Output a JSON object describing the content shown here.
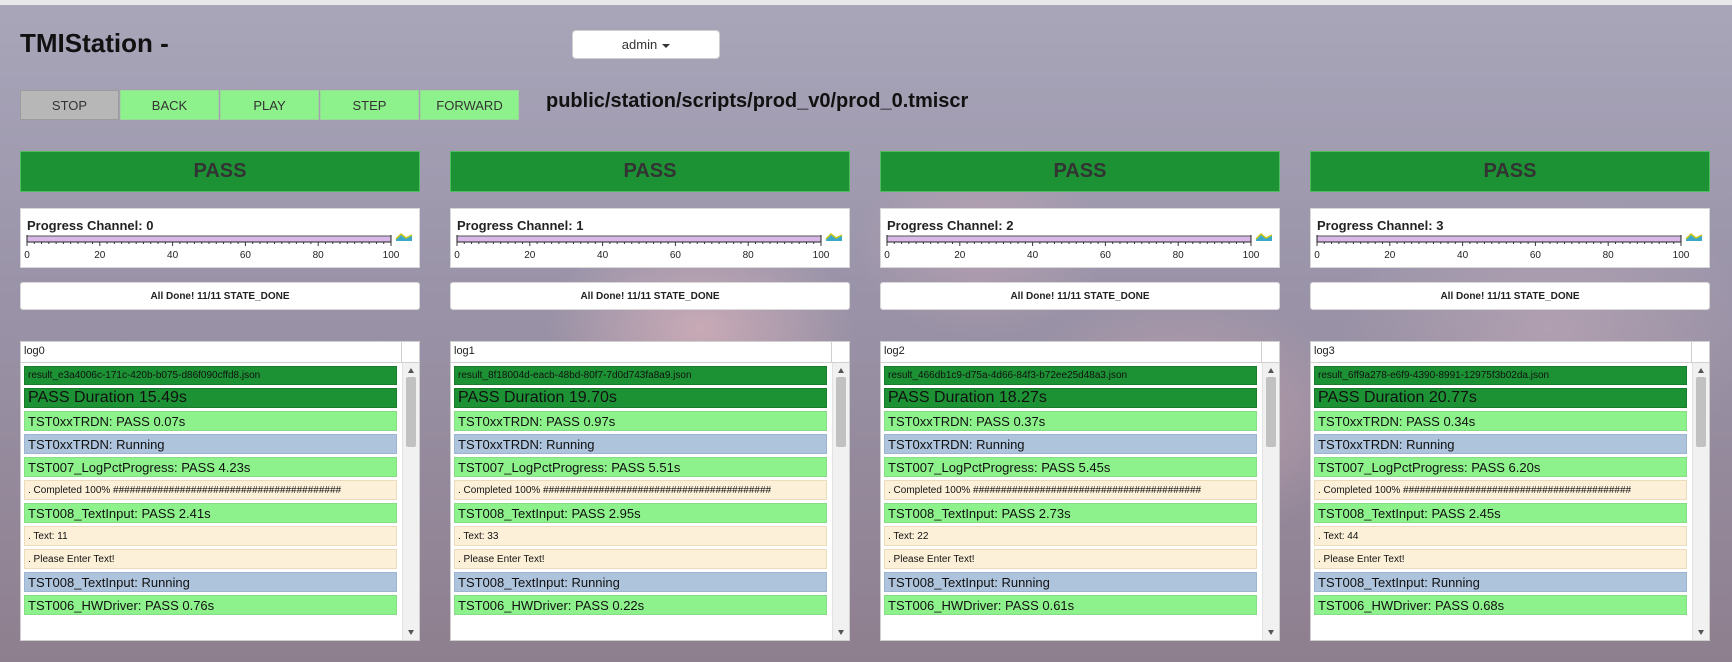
{
  "app": {
    "title": "TMIStation -"
  },
  "user_menu": {
    "label": "admin",
    "icon": "caret-down-icon"
  },
  "controls": [
    {
      "label": "STOP",
      "color": "#b7b7b7"
    },
    {
      "label": "BACK",
      "color": "#8ef28c"
    },
    {
      "label": "PLAY",
      "color": "#8ef28c"
    },
    {
      "label": "STEP",
      "color": "#8ef28c"
    },
    {
      "label": "FORWARD",
      "color": "#8ef28c"
    }
  ],
  "script_path": "public/station/scripts/prod_v0/prod_0.tmiscr",
  "colors": {
    "pass_dark": "#1d9234",
    "pass_light": "#8ef28c",
    "running": "#aec4dd",
    "info": "#fdf0d8",
    "progress_track": "#d8b8e8"
  },
  "channels": [
    {
      "status": "PASS",
      "progress_label": "Progress Channel: 0",
      "progress": 1.0,
      "ticks": [
        "0",
        "20",
        "40",
        "60",
        "80",
        "100"
      ],
      "state": "All Done! 11/11 STATE_DONE",
      "log_title": "log0",
      "log": [
        {
          "type": "result",
          "text": "result_e3a4006c-171c-420b-b075-d86f090cffd8.json"
        },
        {
          "type": "duration",
          "text": "PASS Duration 15.49s"
        },
        {
          "type": "pass",
          "text": "TST0xxTRDN: PASS 0.07s"
        },
        {
          "type": "running",
          "text": "TST0xxTRDN: Running"
        },
        {
          "type": "pass",
          "text": "TST007_LogPctProgress: PASS 4.23s"
        },
        {
          "type": "info",
          "text": ". Completed 100% #########################################"
        },
        {
          "type": "pass",
          "text": "TST008_TextInput: PASS 2.41s"
        },
        {
          "type": "info",
          "text": ". Text: 11"
        },
        {
          "type": "info",
          "text": ". Please Enter Text!"
        },
        {
          "type": "running",
          "text": "TST008_TextInput: Running"
        },
        {
          "type": "pass",
          "text": "TST006_HWDriver: PASS 0.76s"
        }
      ]
    },
    {
      "status": "PASS",
      "progress_label": "Progress Channel: 1",
      "progress": 1.0,
      "ticks": [
        "0",
        "20",
        "40",
        "60",
        "80",
        "100"
      ],
      "state": "All Done! 11/11 STATE_DONE",
      "log_title": "log1",
      "log": [
        {
          "type": "result",
          "text": "result_8f18004d-eacb-48bd-80f7-7d0d743fa8a9.json"
        },
        {
          "type": "duration",
          "text": "PASS Duration 19.70s"
        },
        {
          "type": "pass",
          "text": "TST0xxTRDN: PASS 0.97s"
        },
        {
          "type": "running",
          "text": "TST0xxTRDN: Running"
        },
        {
          "type": "pass",
          "text": "TST007_LogPctProgress: PASS 5.51s"
        },
        {
          "type": "info",
          "text": ". Completed 100% #########################################"
        },
        {
          "type": "pass",
          "text": "TST008_TextInput: PASS 2.95s"
        },
        {
          "type": "info",
          "text": ". Text: 33"
        },
        {
          "type": "info",
          "text": ". Please Enter Text!"
        },
        {
          "type": "running",
          "text": "TST008_TextInput: Running"
        },
        {
          "type": "pass",
          "text": "TST006_HWDriver: PASS 0.22s"
        }
      ]
    },
    {
      "status": "PASS",
      "progress_label": "Progress Channel: 2",
      "progress": 1.0,
      "ticks": [
        "0",
        "20",
        "40",
        "60",
        "80",
        "100"
      ],
      "state": "All Done! 11/11 STATE_DONE",
      "log_title": "log2",
      "log": [
        {
          "type": "result",
          "text": "result_466db1c9-d75a-4d66-84f3-b72ee25d48a3.json"
        },
        {
          "type": "duration",
          "text": "PASS Duration 18.27s"
        },
        {
          "type": "pass",
          "text": "TST0xxTRDN: PASS 0.37s"
        },
        {
          "type": "running",
          "text": "TST0xxTRDN: Running"
        },
        {
          "type": "pass",
          "text": "TST007_LogPctProgress: PASS 5.45s"
        },
        {
          "type": "info",
          "text": ". Completed 100% #########################################"
        },
        {
          "type": "pass",
          "text": "TST008_TextInput: PASS 2.73s"
        },
        {
          "type": "info",
          "text": ". Text: 22"
        },
        {
          "type": "info",
          "text": ". Please Enter Text!"
        },
        {
          "type": "running",
          "text": "TST008_TextInput: Running"
        },
        {
          "type": "pass",
          "text": "TST006_HWDriver: PASS 0.61s"
        }
      ]
    },
    {
      "status": "PASS",
      "progress_label": "Progress Channel: 3",
      "progress": 1.0,
      "ticks": [
        "0",
        "20",
        "40",
        "60",
        "80",
        "100"
      ],
      "state": "All Done! 11/11 STATE_DONE",
      "log_title": "log3",
      "log": [
        {
          "type": "result",
          "text": "result_6ff9a278-e6f9-4390-8991-12975f3b02da.json"
        },
        {
          "type": "duration",
          "text": "PASS Duration 20.77s"
        },
        {
          "type": "pass",
          "text": "TST0xxTRDN: PASS 0.34s"
        },
        {
          "type": "running",
          "text": "TST0xxTRDN: Running"
        },
        {
          "type": "pass",
          "text": "TST007_LogPctProgress: PASS 6.20s"
        },
        {
          "type": "info",
          "text": ". Completed 100% #########################################"
        },
        {
          "type": "pass",
          "text": "TST008_TextInput: PASS 2.45s"
        },
        {
          "type": "info",
          "text": ". Text: 44"
        },
        {
          "type": "info",
          "text": ". Please Enter Text!"
        },
        {
          "type": "running",
          "text": "TST008_TextInput: Running"
        },
        {
          "type": "pass",
          "text": "TST006_HWDriver: PASS 0.68s"
        }
      ]
    }
  ]
}
